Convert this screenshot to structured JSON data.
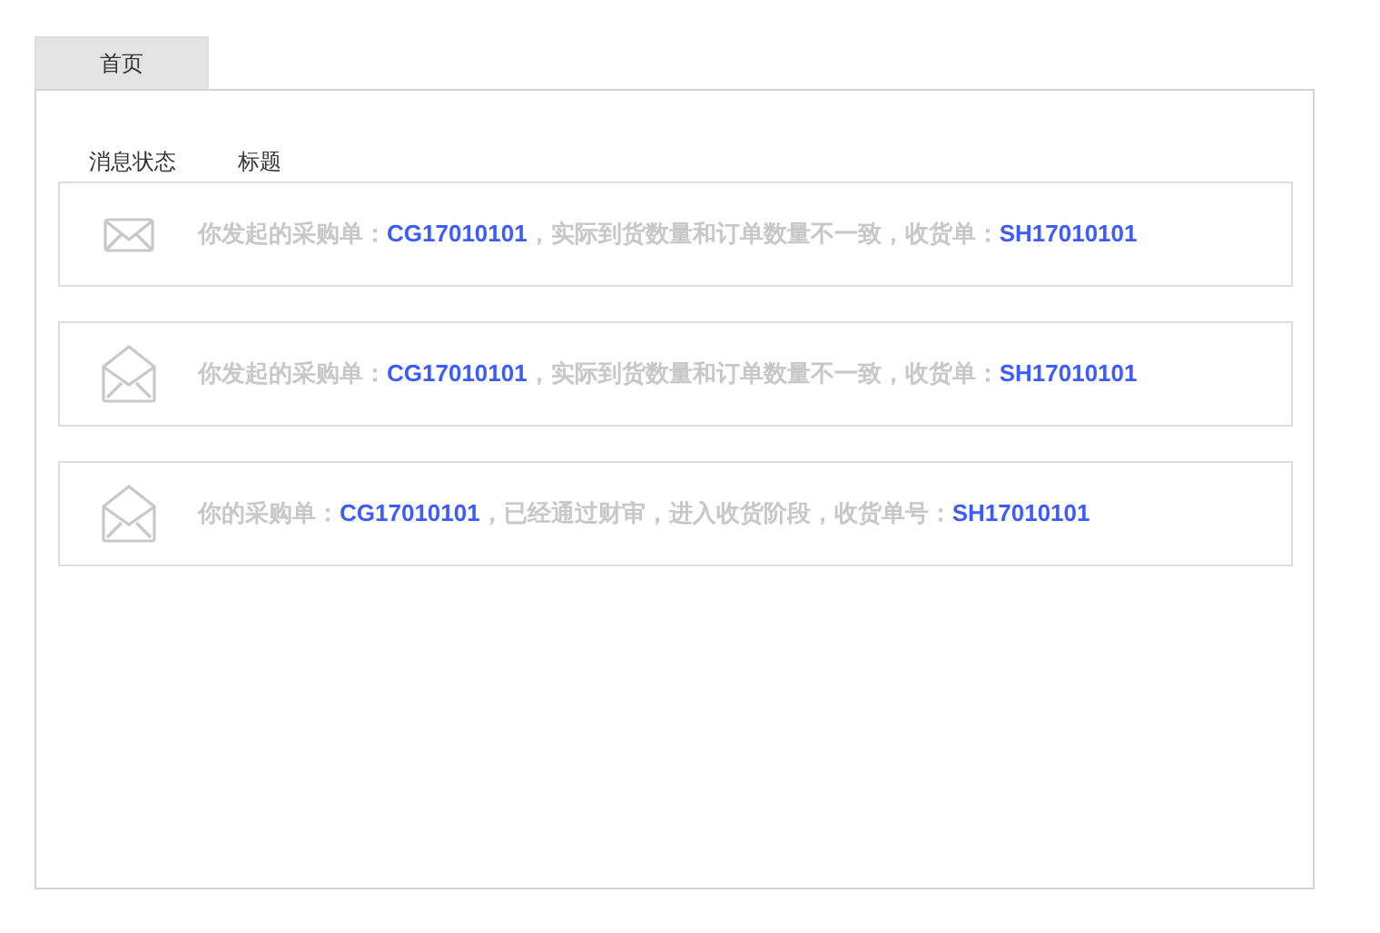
{
  "tabs": [
    {
      "label": "首页",
      "selected": true
    }
  ],
  "columns": [
    "消息状态",
    "标题"
  ],
  "messages": [
    {
      "read": false,
      "parts": [
        {
          "kind": "text",
          "text": "你发起的采购单："
        },
        {
          "kind": "link",
          "text": "CG17010101"
        },
        {
          "kind": "text",
          "text": "，实际到货数量和订单数量不一致，收货单："
        },
        {
          "kind": "link",
          "text": "SH17010101"
        }
      ]
    },
    {
      "read": true,
      "parts": [
        {
          "kind": "text",
          "text": "你发起的采购单："
        },
        {
          "kind": "link",
          "text": "CG17010101"
        },
        {
          "kind": "text",
          "text": "，实际到货数量和订单数量不一致，收货单："
        },
        {
          "kind": "link",
          "text": "SH17010101"
        }
      ]
    },
    {
      "read": true,
      "parts": [
        {
          "kind": "text",
          "text": "你的采购单："
        },
        {
          "kind": "link",
          "text": "CG17010101"
        },
        {
          "kind": "text",
          "text": "，已经通过财审，进入收货阶段，收货单号："
        },
        {
          "kind": "link",
          "text": "SH17010101"
        }
      ]
    }
  ]
}
